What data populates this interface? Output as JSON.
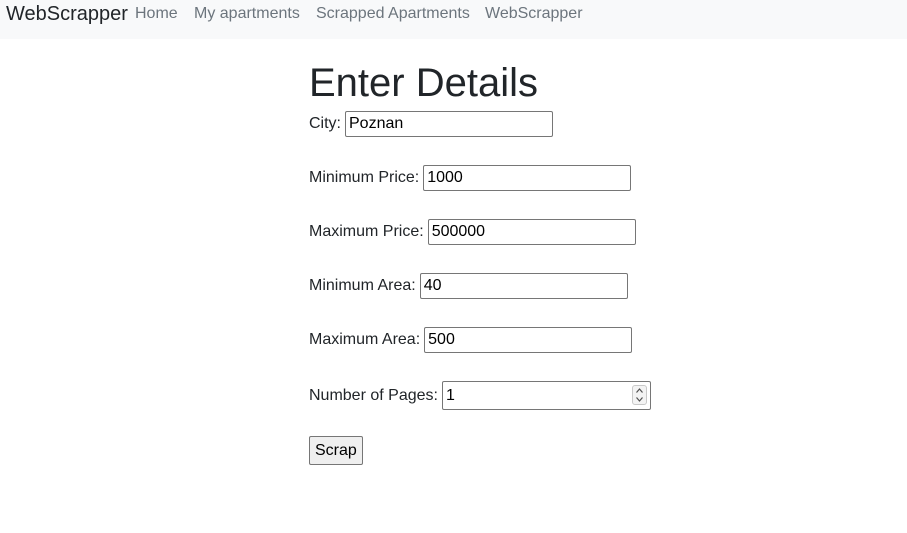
{
  "navbar": {
    "brand": "WebScrapper",
    "links": [
      "Home",
      "My apartments",
      "Scrapped Apartments",
      "WebScrapper"
    ]
  },
  "form": {
    "title": "Enter Details",
    "fields": {
      "city": {
        "label": "City:",
        "value": "Poznan"
      },
      "min_price": {
        "label": "Minimum Price:",
        "value": "1000"
      },
      "max_price": {
        "label": "Maximum Price:",
        "value": "500000"
      },
      "min_area": {
        "label": "Minimum Area:",
        "value": "40"
      },
      "max_area": {
        "label": "Maximum Area:",
        "value": "500"
      },
      "pages": {
        "label": "Number of Pages:",
        "value": "1"
      }
    },
    "submit_label": "Scrap"
  },
  "icons": {
    "spinner_up": "chevron-up-icon",
    "spinner_down": "chevron-down-icon"
  }
}
